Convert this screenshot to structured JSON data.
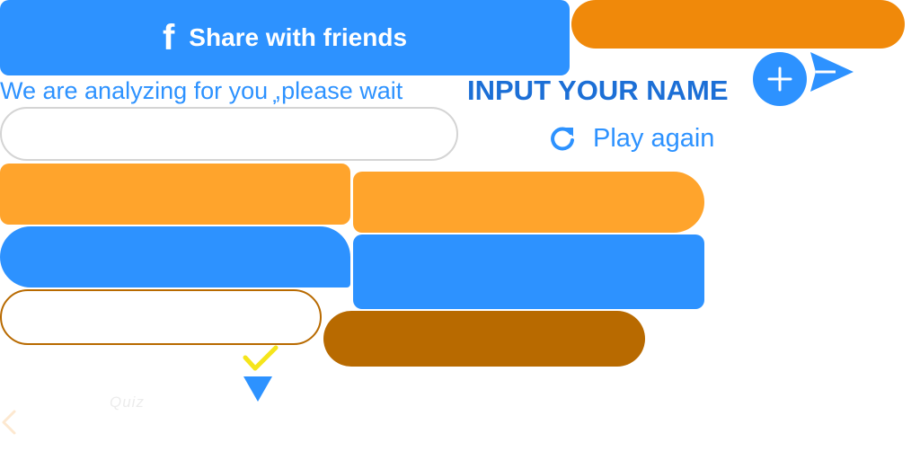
{
  "share": {
    "icon": "facebook-icon",
    "label": "Share with friends",
    "color": "#2d92ff"
  },
  "status": {
    "analyzing_text": "We are analyzing for you ̦,please wait"
  },
  "name_prompt": {
    "title": "INPUT YOUR NAME",
    "field_value": "",
    "add_icon": "plus-icon",
    "send_icon": "send-arrow-icon"
  },
  "play_again": {
    "icon": "refresh-icon",
    "label": "Play again"
  },
  "quiz": {
    "watermark": "Quiz"
  },
  "colors": {
    "primary_blue": "#2d92ff",
    "dark_blue": "#1c6fd6",
    "orange": "#ffa42c",
    "dark_orange": "#f0890a",
    "brown": "#b86a00",
    "check_yellow": "#f5e51b"
  },
  "icons": {
    "check": "check-icon",
    "down_arrow": "down-triangle-icon",
    "back": "chevron-left-icon"
  }
}
